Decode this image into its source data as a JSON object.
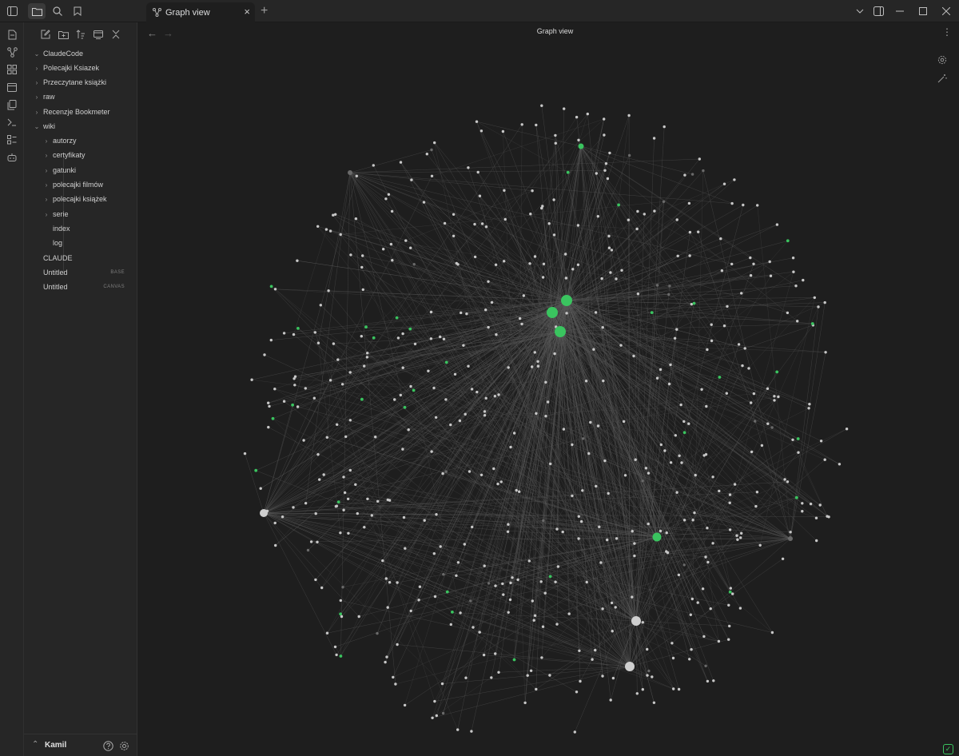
{
  "tab": {
    "title": "Graph view"
  },
  "view": {
    "title": "Graph view"
  },
  "sidebar": {
    "tree": [
      {
        "label": "ClaudeCode",
        "chevron": "expanded"
      },
      {
        "label": "Polecajki Ksiazek",
        "chevron": "collapsed"
      },
      {
        "label": "Przeczytane książki",
        "chevron": "collapsed"
      },
      {
        "label": "raw",
        "chevron": "collapsed"
      },
      {
        "label": "Recenzje Bookmeter",
        "chevron": "collapsed"
      },
      {
        "label": "wiki",
        "chevron": "expanded"
      },
      {
        "label": "autorzy",
        "chevron": "collapsed"
      },
      {
        "label": "certyfikaty",
        "chevron": "collapsed"
      },
      {
        "label": "gatunki",
        "chevron": "collapsed"
      },
      {
        "label": "polecajki filmów",
        "chevron": "collapsed"
      },
      {
        "label": "polecajki książek",
        "chevron": "collapsed"
      },
      {
        "label": "serie",
        "chevron": "collapsed"
      },
      {
        "label": "index",
        "chevron": "none"
      },
      {
        "label": "log",
        "chevron": "none"
      },
      {
        "label": "CLAUDE",
        "chevron": "none"
      },
      {
        "label": "Untitled",
        "tag": "BASE"
      },
      {
        "label": "Untitled",
        "tag": "CANVAS"
      }
    ]
  },
  "footer": {
    "vault": "Kamil"
  },
  "graph": {
    "node_color": "#c8c8c8",
    "highlight_color": "#3ac45f",
    "background": "#1e1e1e"
  }
}
